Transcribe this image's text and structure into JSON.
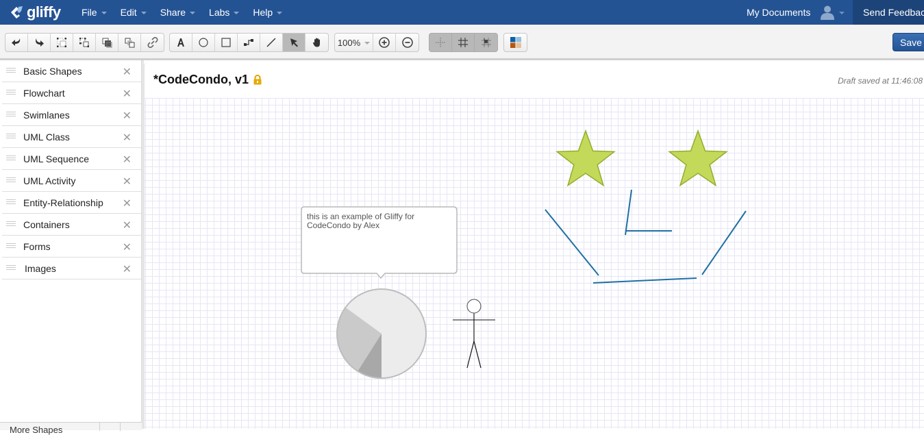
{
  "app": {
    "brand": "gliffy",
    "menu": [
      {
        "label": "File"
      },
      {
        "label": "Edit"
      },
      {
        "label": "Share"
      },
      {
        "label": "Labs"
      },
      {
        "label": "Help"
      }
    ],
    "my_documents": "My Documents",
    "send_feedback": "Send Feedback",
    "user_icon": "user-icon"
  },
  "toolbar": {
    "history": [
      "undo-icon",
      "redo-icon"
    ],
    "arrange": [
      "group-icon",
      "ungroup-icon",
      "bring-to-front-icon",
      "send-to-back-icon",
      "link-icon"
    ],
    "tools": [
      "text-tool-icon",
      "ellipse-tool-icon",
      "rectangle-tool-icon",
      "connector-tool-icon",
      "line-tool-icon",
      "pointer-tool-icon",
      "hand-tool-icon"
    ],
    "active_tool": "pointer-tool-icon",
    "zoom_level": "100%",
    "zoom_buttons": [
      "zoom-in-icon",
      "zoom-out-icon"
    ],
    "grid_buttons": [
      "guides-icon",
      "grid-icon",
      "snap-to-grid-icon"
    ],
    "theme_button": "theme-icon",
    "theme_colors": [
      "#0f5fa6",
      "#94bfe0",
      "#b5580f",
      "#e6c29b"
    ],
    "save_label": "Save"
  },
  "sidebar": {
    "libraries": [
      {
        "label": "Basic Shapes"
      },
      {
        "label": "Flowchart"
      },
      {
        "label": "Swimlanes"
      },
      {
        "label": "UML Class"
      },
      {
        "label": "UML Sequence"
      },
      {
        "label": "UML Activity"
      },
      {
        "label": "Entity-Relationship"
      },
      {
        "label": "Containers"
      },
      {
        "label": "Forms"
      },
      {
        "label": "Images"
      }
    ],
    "close_glyph": "✕",
    "footer_label": "More Shapes"
  },
  "document": {
    "title": "*CodeCondo, v1",
    "locked": true,
    "draft_status": "Draft saved at 11:46:08"
  },
  "canvas": {
    "note_text": "this is an example of Gliffy for CodeCondo by Alex",
    "star_color": "#c3d95a",
    "star_stroke": "#93ad2c",
    "line_color": "#1f6fa3",
    "pie_slices_percent": [
      65,
      26,
      9
    ],
    "pie_colors": [
      "#ececec",
      "#cacaca",
      "#a8a8a8"
    ]
  }
}
